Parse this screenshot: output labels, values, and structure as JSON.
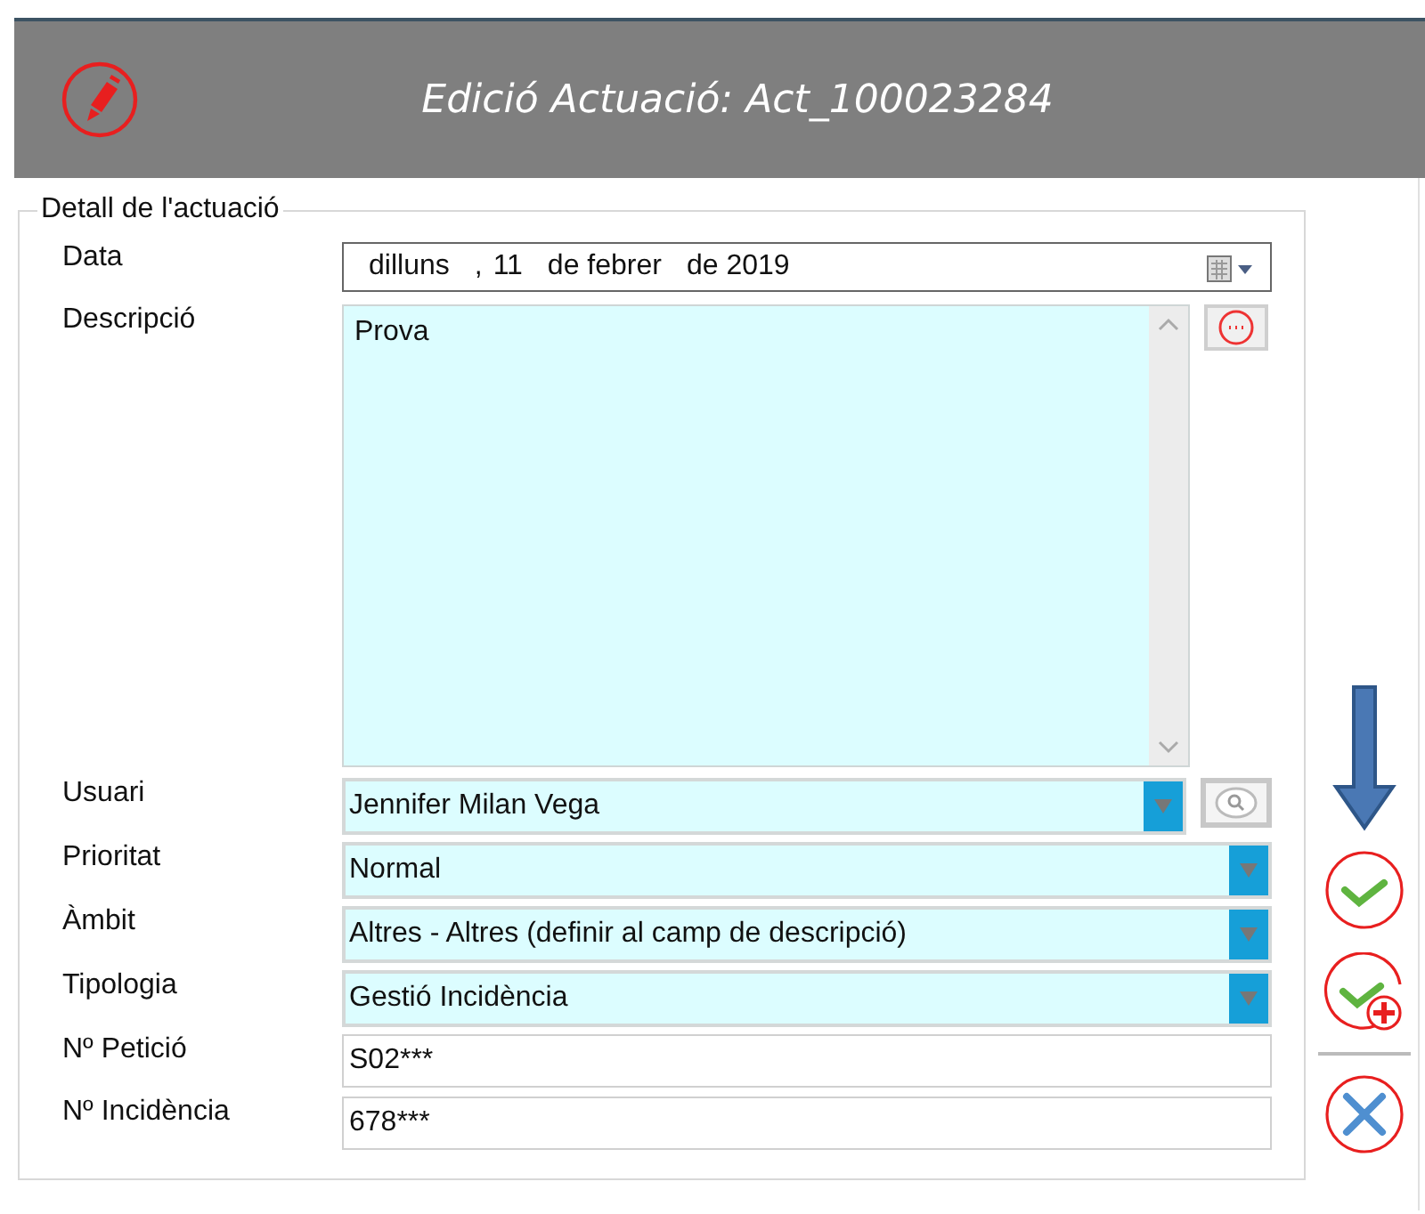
{
  "window": {
    "title": "Edició Actuació: Act_100023284"
  },
  "section": {
    "legend": "Detall de l'actuació"
  },
  "fields": [
    {
      "kind": "date",
      "label": "Data",
      "parts": [
        "dilluns",
        ",",
        "11",
        "de febrer",
        "de 2019"
      ]
    },
    {
      "kind": "textarea",
      "label": "Descripció",
      "value": "Prova"
    },
    {
      "kind": "combo",
      "label": "Usuari",
      "value": "Jennifer Milan Vega",
      "lookup": true
    },
    {
      "kind": "combo",
      "label": "Prioritat",
      "value": "Normal",
      "lookup": false
    },
    {
      "kind": "combo",
      "label": "Àmbit",
      "value": "Altres - Altres (definir al camp de descripció)",
      "lookup": false
    },
    {
      "kind": "combo",
      "label": "Tipologia",
      "value": "Gestió Incidència",
      "lookup": false
    },
    {
      "kind": "input",
      "label": "Nº Petició",
      "value": "S02***"
    },
    {
      "kind": "input",
      "label": "Nº Incidència",
      "value": "678***"
    }
  ],
  "actions": [
    {
      "kind": "hint"
    },
    {
      "kind": "save"
    },
    {
      "kind": "save_new"
    },
    {
      "kind": "separator"
    },
    {
      "kind": "cancel"
    }
  ]
}
